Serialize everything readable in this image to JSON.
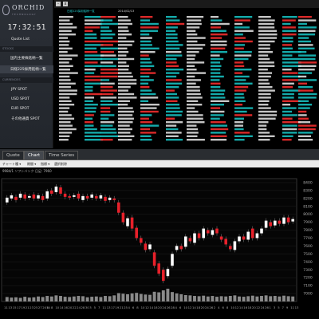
{
  "app": {
    "logo": "ORCHID",
    "logo_sub": "TECHNOLOGY",
    "clock": "17:32:51"
  },
  "sidebar": {
    "quote_list": "Quote List",
    "stocks_header": "STOCKS",
    "stock_items": [
      "国内主要株銘柄一覧",
      "日経225採用銘柄一覧"
    ],
    "currencies_header": "CURRENCIES",
    "currency_items": [
      "JPY SPOT",
      "USD SPOT",
      "EUR SPOT",
      "その他通貨 SPOT"
    ]
  },
  "board": {
    "title": "日経225採用銘柄一覧",
    "date": "2014/02/13",
    "minimize": "-",
    "close": "x",
    "colors": {
      "cyan": "#19c8c8",
      "red": "#ff3030",
      "white": "#e8e8e8"
    }
  },
  "tabs": [
    "Quote",
    "Chart",
    "Time Series"
  ],
  "active_tab": "Chart",
  "toolbar": [
    "チャート種 ▾",
    "期間 ▾",
    "指標 ▾",
    "選択削除"
  ],
  "chart_caption": "9984/1 ソフトバンク 日足: 7960",
  "chart_data": {
    "type": "candlestick",
    "ylim": [
      6900,
      8450
    ],
    "yticks": [
      7000,
      7100,
      7200,
      7300,
      7400,
      7500,
      7600,
      7700,
      7800,
      7900,
      8000,
      8100,
      8200,
      8300,
      8400
    ],
    "xticks": [
      "11",
      "13",
      "15",
      "17",
      "19",
      "21",
      "23",
      "25",
      "27",
      "2014",
      "6",
      "8",
      "10",
      "14",
      "16",
      "20",
      "22",
      "24",
      "28",
      "30",
      "3",
      "5",
      "7",
      "11",
      "13",
      "17",
      "19",
      "21",
      "25",
      "4",
      "6",
      "8",
      "10",
      "12",
      "14",
      "18",
      "20",
      "24",
      "26",
      "28",
      "4",
      "6",
      "10",
      "12",
      "14",
      "18",
      "20",
      "24",
      "26",
      "2",
      "4",
      "6",
      "8",
      "10",
      "12",
      "14",
      "16",
      "18",
      "20",
      "22",
      "24",
      "26",
      "1",
      "3",
      "5",
      "7",
      "9",
      "11",
      "13"
    ],
    "candles": [
      {
        "o": 8150,
        "c": 8210
      },
      {
        "o": 8200,
        "c": 8240
      },
      {
        "o": 8220,
        "c": 8180
      },
      {
        "o": 8210,
        "c": 8260
      },
      {
        "o": 8250,
        "c": 8200
      },
      {
        "o": 8210,
        "c": 8230
      },
      {
        "o": 8250,
        "c": 8200
      },
      {
        "o": 8200,
        "c": 8240
      },
      {
        "o": 8230,
        "c": 8180
      },
      {
        "o": 8200,
        "c": 8290
      },
      {
        "o": 8300,
        "c": 8260
      },
      {
        "o": 8280,
        "c": 8350
      },
      {
        "o": 8340,
        "c": 8260
      },
      {
        "o": 8260,
        "c": 8220
      },
      {
        "o": 8230,
        "c": 8210
      },
      {
        "o": 8220,
        "c": 8240
      },
      {
        "o": 8260,
        "c": 8200
      },
      {
        "o": 8180,
        "c": 8230
      },
      {
        "o": 8230,
        "c": 8200
      },
      {
        "o": 8210,
        "c": 8250
      },
      {
        "o": 8230,
        "c": 8200
      },
      {
        "o": 8200,
        "c": 8240
      },
      {
        "o": 8220,
        "c": 8170
      },
      {
        "o": 8180,
        "c": 8210
      },
      {
        "o": 8200,
        "c": 8180
      },
      {
        "o": 8150,
        "c": 8020
      },
      {
        "o": 8020,
        "c": 7900
      },
      {
        "o": 7850,
        "c": 7950
      },
      {
        "o": 7960,
        "c": 7820
      },
      {
        "o": 7830,
        "c": 7700
      },
      {
        "o": 7700,
        "c": 7640
      },
      {
        "o": 7630,
        "c": 7550
      },
      {
        "o": 7560,
        "c": 7620
      },
      {
        "o": 7520,
        "c": 7350
      },
      {
        "o": 7380,
        "c": 7250
      },
      {
        "o": 7300,
        "c": 7160
      },
      {
        "o": 7220,
        "c": 7310
      },
      {
        "o": 7350,
        "c": 7500
      },
      {
        "o": 7550,
        "c": 7600
      },
      {
        "o": 7600,
        "c": 7560
      },
      {
        "o": 7590,
        "c": 7720
      },
      {
        "o": 7700,
        "c": 7660
      },
      {
        "o": 7640,
        "c": 7760
      },
      {
        "o": 7760,
        "c": 7700
      },
      {
        "o": 7700,
        "c": 7820
      },
      {
        "o": 7800,
        "c": 7760
      },
      {
        "o": 7740,
        "c": 7800
      },
      {
        "o": 7820,
        "c": 7760
      },
      {
        "o": 7720,
        "c": 7680
      },
      {
        "o": 7690,
        "c": 7620
      },
      {
        "o": 7600,
        "c": 7560
      },
      {
        "o": 7550,
        "c": 7660
      },
      {
        "o": 7660,
        "c": 7720
      },
      {
        "o": 7720,
        "c": 7680
      },
      {
        "o": 7680,
        "c": 7780
      },
      {
        "o": 7820,
        "c": 7700
      },
      {
        "o": 7700,
        "c": 7760
      },
      {
        "o": 7760,
        "c": 7820
      },
      {
        "o": 7830,
        "c": 7920
      },
      {
        "o": 7900,
        "c": 7850
      },
      {
        "o": 7860,
        "c": 7920
      },
      {
        "o": 7920,
        "c": 7880
      },
      {
        "o": 7880,
        "c": 7960
      },
      {
        "o": 7960,
        "c": 7900
      },
      {
        "o": 7910,
        "c": 7940
      }
    ],
    "volume": [
      32,
      28,
      30,
      26,
      34,
      28,
      30,
      36,
      32,
      40,
      36,
      44,
      40,
      34,
      32,
      36,
      40,
      38,
      30,
      34,
      36,
      32,
      40,
      38,
      44,
      60,
      56,
      52,
      58,
      62,
      54,
      50,
      48,
      70,
      66,
      80,
      92,
      68,
      58,
      52,
      46,
      44,
      40,
      38,
      42,
      36,
      40,
      34,
      38,
      36,
      40,
      44,
      36,
      34,
      38,
      42,
      36,
      40,
      44,
      38,
      40,
      36,
      42,
      38,
      36
    ]
  }
}
